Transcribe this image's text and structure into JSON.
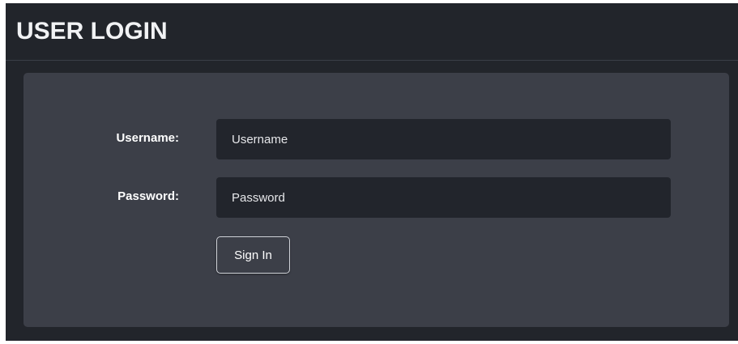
{
  "header": {
    "title": "USER LOGIN"
  },
  "form": {
    "username_label": "Username:",
    "username_placeholder": "Username",
    "username_value": "",
    "password_label": "Password:",
    "password_placeholder": "Password",
    "password_value": "",
    "submit_label": "Sign In"
  },
  "colors": {
    "page_background": "#22252b",
    "panel_background": "#3c3f48",
    "input_background": "#22252c",
    "text": "#ffffff"
  }
}
